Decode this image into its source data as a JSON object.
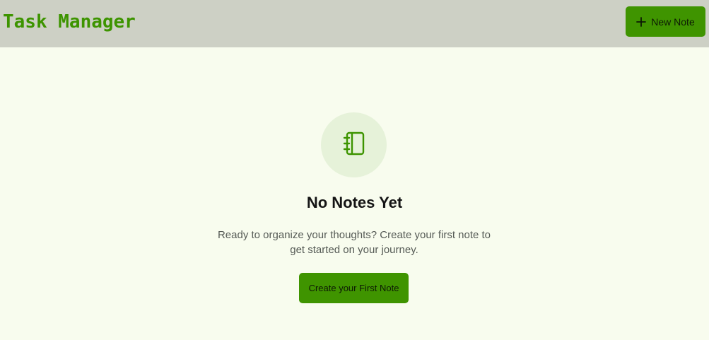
{
  "header": {
    "title": "Task Manager",
    "new_note_label": "New Note",
    "new_note_icon": "plus-icon"
  },
  "empty_state": {
    "icon": "notebook-icon",
    "title": "No Notes Yet",
    "description": "Ready to organize your thoughts? Create your first note to get started on your journey.",
    "cta_label": "Create your First Note"
  },
  "colors": {
    "accent": "#3f9400",
    "header_bg": "#cdd0c5",
    "page_bg": "#f8fcee",
    "icon_circle_bg": "#e6f2d9"
  }
}
